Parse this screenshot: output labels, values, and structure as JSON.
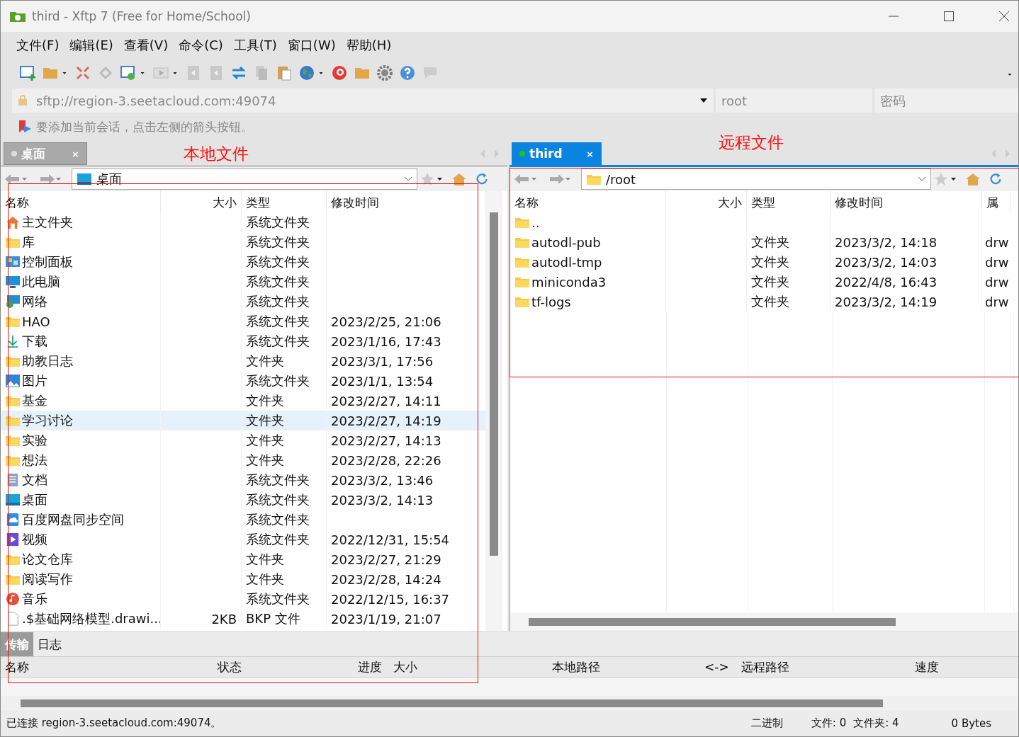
{
  "window": {
    "title": "third - Xftp 7 (Free for Home/School)"
  },
  "menu": [
    "文件(F)",
    "编辑(E)",
    "查看(V)",
    "命令(C)",
    "工具(T)",
    "窗口(W)",
    "帮助(H)"
  ],
  "address": {
    "value": "sftp://region-3.seetacloud.com:49074",
    "user_placeholder": "root",
    "password_placeholder": "密码"
  },
  "hint": "要添加当前会话，点击左侧的箭头按钮。",
  "annotations": [
    "本地文件",
    "远程文件"
  ],
  "local": {
    "tab": {
      "label": "桌面",
      "close": "×",
      "selected": false
    },
    "path": "桌面",
    "columns": [
      "名称",
      "大小",
      "类型",
      "修改时间"
    ],
    "rows": [
      {
        "kind": "home",
        "name": "主文件夹",
        "size": "",
        "type": "系统文件夹",
        "modified": "",
        "selected": false
      },
      {
        "kind": "folder",
        "name": "库",
        "size": "",
        "type": "系统文件夹",
        "modified": "",
        "selected": false
      },
      {
        "kind": "panel",
        "name": "控制面板",
        "size": "",
        "type": "系统文件夹",
        "modified": "",
        "selected": false
      },
      {
        "kind": "computer",
        "name": "此电脑",
        "size": "",
        "type": "系统文件夹",
        "modified": "",
        "selected": false
      },
      {
        "kind": "network",
        "name": "网络",
        "size": "",
        "type": "系统文件夹",
        "modified": "",
        "selected": false
      },
      {
        "kind": "folder",
        "name": "HAO",
        "size": "",
        "type": "系统文件夹",
        "modified": "2023/2/25, 21:06",
        "selected": false
      },
      {
        "kind": "download",
        "name": "下载",
        "size": "",
        "type": "系统文件夹",
        "modified": "2023/1/16, 17:43",
        "selected": false
      },
      {
        "kind": "folder",
        "name": "助教日志",
        "size": "",
        "type": "文件夹",
        "modified": "2023/3/1, 17:56",
        "selected": false
      },
      {
        "kind": "pictures",
        "name": "图片",
        "size": "",
        "type": "系统文件夹",
        "modified": "2023/1/1, 13:54",
        "selected": false
      },
      {
        "kind": "folder",
        "name": "基金",
        "size": "",
        "type": "文件夹",
        "modified": "2023/2/27, 14:11",
        "selected": false
      },
      {
        "kind": "folder",
        "name": "学习讨论",
        "size": "",
        "type": "文件夹",
        "modified": "2023/2/27, 14:19",
        "selected": true
      },
      {
        "kind": "folder",
        "name": "实验",
        "size": "",
        "type": "文件夹",
        "modified": "2023/2/27, 14:13",
        "selected": false
      },
      {
        "kind": "folder",
        "name": "想法",
        "size": "",
        "type": "文件夹",
        "modified": "2023/2/28, 22:26",
        "selected": false
      },
      {
        "kind": "document",
        "name": "文档",
        "size": "",
        "type": "系统文件夹",
        "modified": "2023/3/2, 13:46",
        "selected": false
      },
      {
        "kind": "desktop",
        "name": "桌面",
        "size": "",
        "type": "系统文件夹",
        "modified": "2023/3/2, 14:13",
        "selected": false
      },
      {
        "kind": "cloud",
        "name": "百度网盘同步空间",
        "size": "",
        "type": "系统文件夹",
        "modified": "",
        "selected": false
      },
      {
        "kind": "video",
        "name": "视频",
        "size": "",
        "type": "系统文件夹",
        "modified": "2022/12/31, 15:54",
        "selected": false
      },
      {
        "kind": "folder",
        "name": "论文仓库",
        "size": "",
        "type": "文件夹",
        "modified": "2023/2/27, 21:29",
        "selected": false
      },
      {
        "kind": "folder",
        "name": "阅读写作",
        "size": "",
        "type": "文件夹",
        "modified": "2023/2/28, 14:24",
        "selected": false
      },
      {
        "kind": "music",
        "name": "音乐",
        "size": "",
        "type": "系统文件夹",
        "modified": "2022/12/15, 16:37",
        "selected": false
      },
      {
        "kind": "file",
        "name": ".$基础网络模型.drawi...",
        "size": "2KB",
        "type": "BKP 文件",
        "modified": "2023/1/19, 21:07",
        "selected": false
      }
    ]
  },
  "remote": {
    "tab": {
      "label": "third",
      "close": "×",
      "selected": true
    },
    "path": "/root",
    "columns": [
      "名称",
      "大小",
      "类型",
      "修改时间",
      "属"
    ],
    "rows": [
      {
        "kind": "folder",
        "name": "..",
        "type": "",
        "modified": "",
        "attr": "",
        "selected": false
      },
      {
        "kind": "folder",
        "name": "autodl-pub",
        "type": "文件夹",
        "modified": "2023/3/2, 14:18",
        "attr": "drw",
        "selected": false
      },
      {
        "kind": "folder",
        "name": "autodl-tmp",
        "type": "文件夹",
        "modified": "2023/3/2, 14:03",
        "attr": "drw",
        "selected": false
      },
      {
        "kind": "folder",
        "name": "miniconda3",
        "type": "文件夹",
        "modified": "2022/4/8, 16:43",
        "attr": "drw",
        "selected": false
      },
      {
        "kind": "folder",
        "name": "tf-logs",
        "type": "文件夹",
        "modified": "2023/3/2, 14:19",
        "attr": "drw",
        "selected": false
      }
    ]
  },
  "bottom_tabs": [
    {
      "label": "传输",
      "selected": true
    },
    {
      "label": "日志",
      "selected": false
    }
  ],
  "transfer_columns": [
    "名称",
    "状态",
    "进度",
    "大小",
    "本地路径",
    "<->",
    "远程路径",
    "速度"
  ],
  "status_bar": {
    "message": "已连接 region-3.seetacloud.com:49074。",
    "mode": "二进制",
    "files": "文件: 0",
    "folders": "文件夹: 4",
    "size": "0 Bytes"
  }
}
